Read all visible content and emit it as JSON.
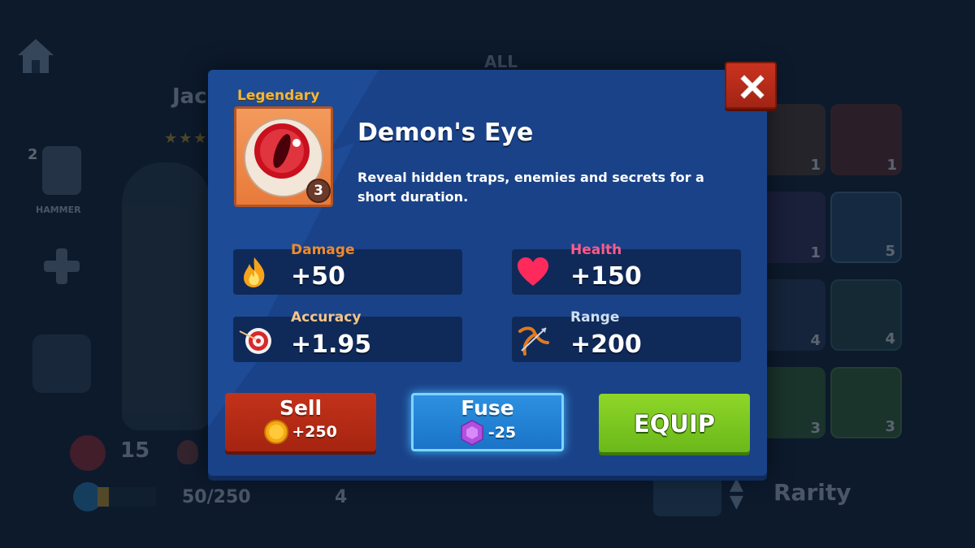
{
  "background": {
    "tab_all": "ALL",
    "hero_name_partial": "Jac",
    "hammer_count": "2",
    "hammer_label": "HAMMER",
    "stat_attack": "15",
    "xp_text": "50/250",
    "xp_progress": 0.2,
    "level_badge": "4",
    "sort_label": "Rarity",
    "inventory_counts": [
      "1",
      "1",
      "1",
      "5",
      "4",
      "4",
      "3",
      "3"
    ]
  },
  "item": {
    "rarity": "Legendary",
    "level": "3",
    "name": "Demon's Eye",
    "description": "Reveal hidden traps, enemies and secrets for a short duration."
  },
  "stats": {
    "damage": {
      "label": "Damage",
      "value": "+50",
      "icon": "flame-icon",
      "color": "#f08a2a"
    },
    "health": {
      "label": "Health",
      "value": "+150",
      "icon": "heart-icon",
      "color": "#ff5a8a"
    },
    "accuracy": {
      "label": "Accuracy",
      "value": "+1.95",
      "icon": "target-icon",
      "color": "#f4c48a"
    },
    "range": {
      "label": "Range",
      "value": "+200",
      "icon": "bow-icon",
      "color": "#cfe0f4"
    }
  },
  "actions": {
    "sell": {
      "label": "Sell",
      "amount": "+250",
      "currency_icon": "coin-icon"
    },
    "fuse": {
      "label": "Fuse",
      "amount": "-25",
      "currency_icon": "gem-icon"
    },
    "equip": {
      "label": "EQUIP"
    }
  },
  "colors": {
    "rarity_legendary": "#f2b63c",
    "modal_bg": "#1d4b96",
    "stat_panel": "#0f2a58",
    "sell_red": "#c3321a",
    "fuse_blue": "#2d90e0",
    "equip_green": "#8fd628"
  }
}
